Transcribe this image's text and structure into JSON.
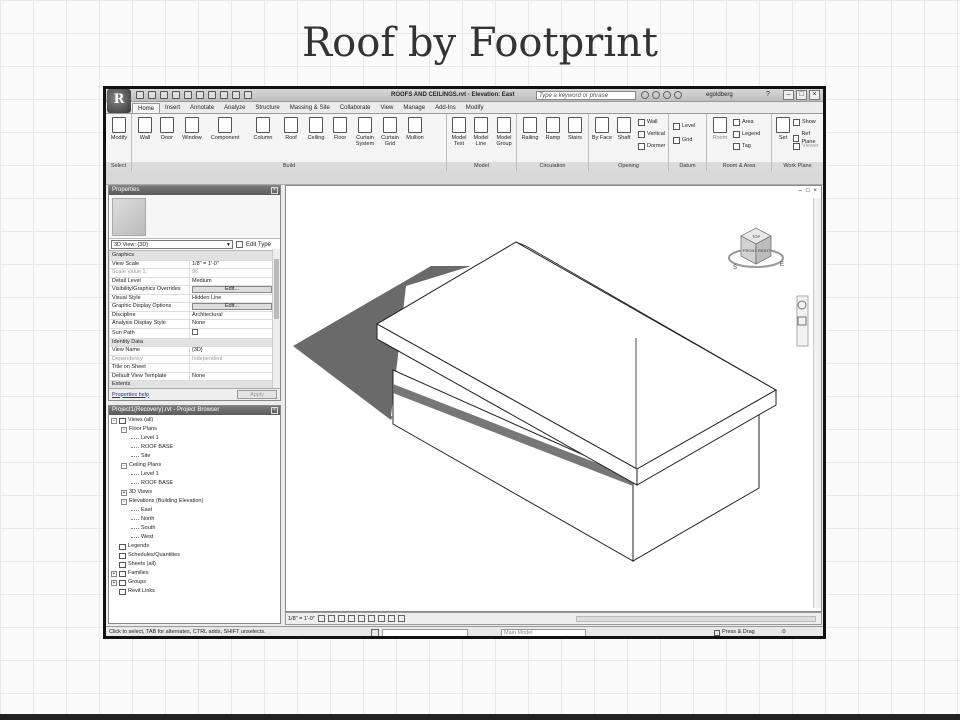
{
  "slide": {
    "title": "Roof by Footprint"
  },
  "app": {
    "logo_letter": "R",
    "doc_title": "ROOFS AND CEILINGS.rvt - Elevation: East",
    "search_placeholder": "Type a keyword or phrase",
    "user": "egoldberg",
    "help": "?"
  },
  "tabs": [
    "Home",
    "Insert",
    "Annotate",
    "Analyze",
    "Structure",
    "Massing & Site",
    "Collaborate",
    "View",
    "Manage",
    "Add-Ins",
    "Modify"
  ],
  "ribbon": {
    "groups": {
      "select": "Select",
      "build": "Build",
      "model": "Model",
      "circulation": "Circulation",
      "opening": "Opening",
      "datum": "Datum",
      "room_area": "Room & Area",
      "work_plane": "Work Plane"
    },
    "buttons": {
      "modify": "Modify",
      "wall": "Wall",
      "door": "Door",
      "window": "Window",
      "component": "Component",
      "column": "Column",
      "roof": "Roof",
      "ceiling": "Ceiling",
      "floor": "Floor",
      "curtain_system": "Curtain System",
      "curtain_grid": "Curtain Grid",
      "mullion": "Mullion",
      "model_text": "Model Text",
      "model_line": "Model Line",
      "model_group": "Model Group",
      "railing": "Railing",
      "ramp": "Ramp",
      "stairs": "Stairs",
      "by_face": "By Face",
      "shaft": "Shaft",
      "wall_small": "Wall",
      "vertical": "Vertical",
      "dormer": "Dormer",
      "level": "Level",
      "grid": "Grid",
      "room": "Room",
      "area": "Area",
      "legend": "Legend",
      "tag": "Tag",
      "set": "Set",
      "show": "Show",
      "ref_plane": "Ref Plane",
      "viewer": "Viewer"
    }
  },
  "properties": {
    "title": "Properties",
    "view_type": "3D View: {3D}",
    "edit_type": "Edit Type",
    "rows": [
      {
        "k": "Graphics",
        "v": "",
        "group": true
      },
      {
        "k": "View Scale",
        "v": "1/8\" = 1'-0\""
      },
      {
        "k": "Scale Value    1:",
        "v": "96",
        "dim": true
      },
      {
        "k": "Detail Level",
        "v": "Medium"
      },
      {
        "k": "Visibility/Graphics Overrides",
        "v": "Edit...",
        "btn": true
      },
      {
        "k": "Visual Style",
        "v": "Hidden Line"
      },
      {
        "k": "Graphic Display Options",
        "v": "Edit...",
        "btn": true
      },
      {
        "k": "Discipline",
        "v": "Architectural"
      },
      {
        "k": "Analysis Display Style",
        "v": "None"
      },
      {
        "k": "Sun Path",
        "v": "",
        "chk": true
      },
      {
        "k": "Identity Data",
        "v": "",
        "group": true
      },
      {
        "k": "View Name",
        "v": "{3D}"
      },
      {
        "k": "Dependency",
        "v": "Independent",
        "dim": true
      },
      {
        "k": "Title on Sheet",
        "v": ""
      },
      {
        "k": "Default View Template",
        "v": "None"
      },
      {
        "k": "Extents",
        "v": "",
        "group": true
      }
    ],
    "help_link": "Properties help",
    "apply": "Apply"
  },
  "browser": {
    "title": "Project1(Recovery).rvt - Project Browser",
    "nodes": [
      {
        "label": "Views (all)",
        "level": 0,
        "pm": "−"
      },
      {
        "label": "Floor Plans",
        "level": 1,
        "pm": "−"
      },
      {
        "label": "Level 1",
        "level": 2
      },
      {
        "label": "ROOF BASE",
        "level": 2
      },
      {
        "label": "Site",
        "level": 2
      },
      {
        "label": "Ceiling Plans",
        "level": 1,
        "pm": "−"
      },
      {
        "label": "Level 1",
        "level": 2
      },
      {
        "label": "ROOF BASE",
        "level": 2
      },
      {
        "label": "3D Views",
        "level": 1,
        "pm": "+"
      },
      {
        "label": "Elevations (Building Elevation)",
        "level": 1,
        "pm": "−"
      },
      {
        "label": "East",
        "level": 2
      },
      {
        "label": "North",
        "level": 2
      },
      {
        "label": "South",
        "level": 2
      },
      {
        "label": "West",
        "level": 2
      },
      {
        "label": "Legends",
        "level": 0,
        "icon": true
      },
      {
        "label": "Schedules/Quantities",
        "level": 0,
        "icon": true
      },
      {
        "label": "Sheets (all)",
        "level": 0,
        "icon": true
      },
      {
        "label": "Families",
        "level": 0,
        "pm": "+"
      },
      {
        "label": "Groups",
        "level": 0,
        "pm": "+"
      },
      {
        "label": "Revit Links",
        "level": 0,
        "icon": true
      }
    ]
  },
  "viewcube": {
    "top": "TOP",
    "front": "FRONT",
    "right": "RIGHT"
  },
  "viewbar": {
    "scale": "1/8\" = 1'-0\""
  },
  "status": {
    "hint": "Click to select, TAB for alternates, CTRL adds, SHIFT unselects.",
    "model": "Main Model",
    "press_drag": "Press & Drag",
    "filter": ":0"
  }
}
